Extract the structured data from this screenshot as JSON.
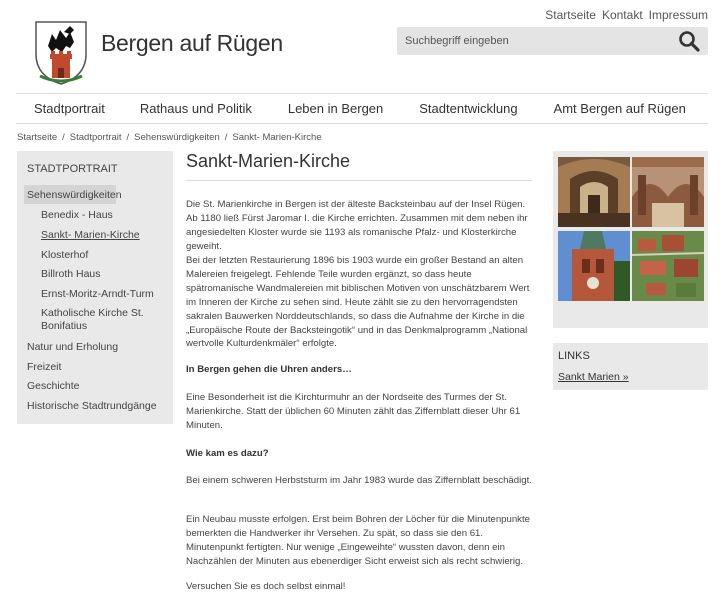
{
  "header": {
    "top_links": [
      "Startseite",
      "Kontakt",
      "Impressum"
    ],
    "site_title": "Bergen auf Rügen",
    "search_placeholder": "Suchbegriff eingeben"
  },
  "nav": [
    "Stadtportrait",
    "Rathaus und Politik",
    "Leben in Bergen",
    "Stadtentwicklung",
    "Amt Bergen auf Rügen"
  ],
  "breadcrumb": [
    "Startseite",
    "Stadtportrait",
    "Sehenswürdigkeiten",
    "Sankt- Marien-Kirche"
  ],
  "sidebar": {
    "title": "STADTPORTRAIT",
    "items": [
      "Sehenswürdigkeiten",
      "Benedix - Haus",
      "Sankt- Marien-Kirche",
      "Klosterhof",
      "Billroth Haus",
      "Ernst-Moritz-Arndt-Turm",
      "Katholische Kirche St. Bonifatius",
      "Natur und Erholung",
      "Freizeit",
      "Geschichte",
      "Historische Stadtrundgänge"
    ]
  },
  "content": {
    "title": "Sankt-Marien-Kirche",
    "p1": "Die St. Marienkirche in Bergen ist der älteste Backsteinbau auf der Insel Rügen. Ab 1180 ließ Fürst Jaromar I. die Kirche errichten. Zusammen mit dem neben ihr angesiedelten Kloster wurde sie 1193 als romanische Pfalz- und Klosterkirche geweiht.",
    "p2": "Bei der letzten Restaurierung 1896 bis 1903 wurde ein großer Bestand an alten Malereien freigelegt. Fehlende Teile wurden ergänzt, so dass heute spätromanische Wandmalereien mit biblischen Motiven von unschätzbarem Wert im Inneren der Kirche zu sehen sind. Heute zählt sie zu den hervorragendsten sakralen Bauwerken Norddeutschlands, so dass die Aufnahme der Kirche in die „Europäische Route der Backsteingotik“ und in das Denkmalprogramm „National wertvolle Kulturdenkmäler“ erfolgte.",
    "h1": "In Bergen gehen die Uhren anders…",
    "p3": "Eine Besonderheit ist die Kirchturmuhr an der Nordseite des Turmes der St. Marienkirche. Statt der üblichen 60 Minuten zählt das Ziffernblatt dieser Uhr 61 Minuten.",
    "h2": "Wie kam es dazu?",
    "p4": "Bei einem schweren Herbststurm im Jahr 1983 wurde das Ziffernblatt beschädigt.",
    "p5": "Ein Neubau musste erfolgen. Erst beim Bohren der Löcher für die Minutenpunkte bemerkten die Handwerker ihr Versehen. Zu spät, so dass sie den 61. Minutenpunkt fertigten. Nur wenige „Eingeweihte“ wussten davon, denn ein Nachzählen der Minuten aus ebenerdiger Sicht erweist sich als recht schwierig.",
    "p6": "Versuchen Sie es doch selbst einmal!"
  },
  "links_box": {
    "title": "LINKS",
    "link": "Sankt Marien »"
  }
}
